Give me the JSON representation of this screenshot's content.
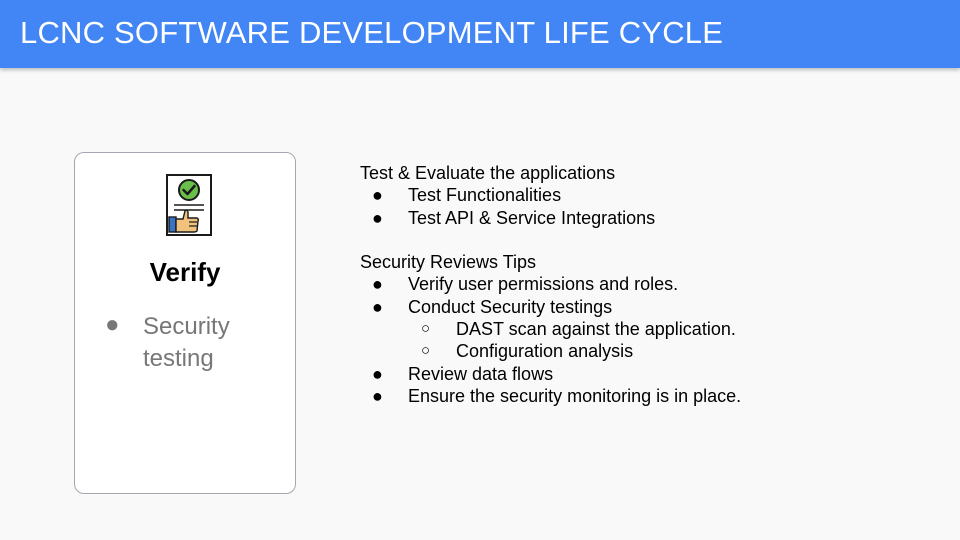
{
  "slide": {
    "title": "LCNC SOFTWARE DEVELOPMENT LIFE CYCLE",
    "title_bar_color": "#4285f4"
  },
  "card": {
    "icon": "approved-document-thumbs-up-icon",
    "title": "Verify",
    "bullet": "●",
    "bullet_text": "Security testing"
  },
  "content": {
    "section1": {
      "heading": "Test & Evaluate the applications",
      "items": [
        "Test Functionalities",
        "Test API & Service Integrations"
      ]
    },
    "section2": {
      "heading": "Security Reviews Tips",
      "item1": "Verify user permissions and roles.",
      "item2": "Conduct Security testings",
      "subitems": [
        "DAST scan against the application.",
        "Configuration analysis"
      ],
      "item3": "Review data flows",
      "item4": "Ensure the security monitoring is in place."
    },
    "bullet": "●",
    "subbullet": "○"
  }
}
